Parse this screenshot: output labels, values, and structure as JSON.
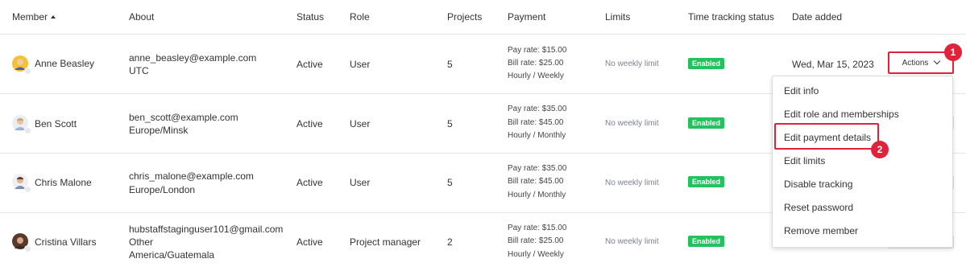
{
  "headers": {
    "member": "Member",
    "about": "About",
    "status": "Status",
    "role": "Role",
    "projects": "Projects",
    "payment": "Payment",
    "limits": "Limits",
    "time_tracking": "Time tracking status",
    "date_added": "Date added"
  },
  "rows": [
    {
      "name": "Anne Beasley",
      "email": "anne_beasley@example.com",
      "timezone": "UTC",
      "status": "Active",
      "role": "User",
      "projects": "5",
      "pay_rate": "Pay rate: $15.00",
      "bill_rate": "Bill rate: $25.00",
      "period_a": "Hourly",
      "period_sep": " / ",
      "period_b": "Weekly",
      "limits": "No weekly limit",
      "tracking": "Enabled",
      "date_added": "Wed, Mar 15, 2023",
      "avatar_color": "#f2c230"
    },
    {
      "name": "Ben Scott",
      "email": "ben_scott@example.com",
      "timezone": "Europe/Minsk",
      "status": "Active",
      "role": "User",
      "projects": "5",
      "pay_rate": "Pay rate: $35.00",
      "bill_rate": "Bill rate: $45.00",
      "period_a": "Hourly",
      "period_sep": " / ",
      "period_b": "Monthly",
      "limits": "No weekly limit",
      "tracking": "Enabled",
      "avatar_color": "#9cb4cf"
    },
    {
      "name": "Chris Malone",
      "email": "chris_malone@example.com",
      "timezone": "Europe/London",
      "status": "Active",
      "role": "User",
      "projects": "5",
      "pay_rate": "Pay rate: $35.00",
      "bill_rate": "Bill rate: $45.00",
      "period_a": "Hourly",
      "period_sep": " / ",
      "period_b": "Monthly",
      "limits": "No weekly limit",
      "tracking": "Enabled",
      "avatar_color": "#7a8db5"
    },
    {
      "name": "Cristina Villars",
      "email": "hubstaffstaginguser101@gmail.com",
      "line2": "Other",
      "timezone": "America/Guatemala",
      "status": "Active",
      "role": "Project manager",
      "projects": "2",
      "pay_rate": "Pay rate: $15.00",
      "bill_rate": "Bill rate: $25.00",
      "period_a": "Hourly",
      "period_sep": " / ",
      "period_b": "Weekly",
      "limits": "No weekly limit",
      "tracking": "Enabled",
      "avatar_color": "#5a3a2e"
    }
  ],
  "actions": {
    "label": "Actions",
    "menu": [
      "Edit info",
      "Edit role and memberships",
      "Edit payment details",
      "Edit limits",
      "Disable tracking",
      "Reset password",
      "Remove member"
    ]
  },
  "markers": [
    "1",
    "2"
  ],
  "colors": {
    "accent_red": "#e0233a",
    "enabled_green": "#22c35e"
  }
}
